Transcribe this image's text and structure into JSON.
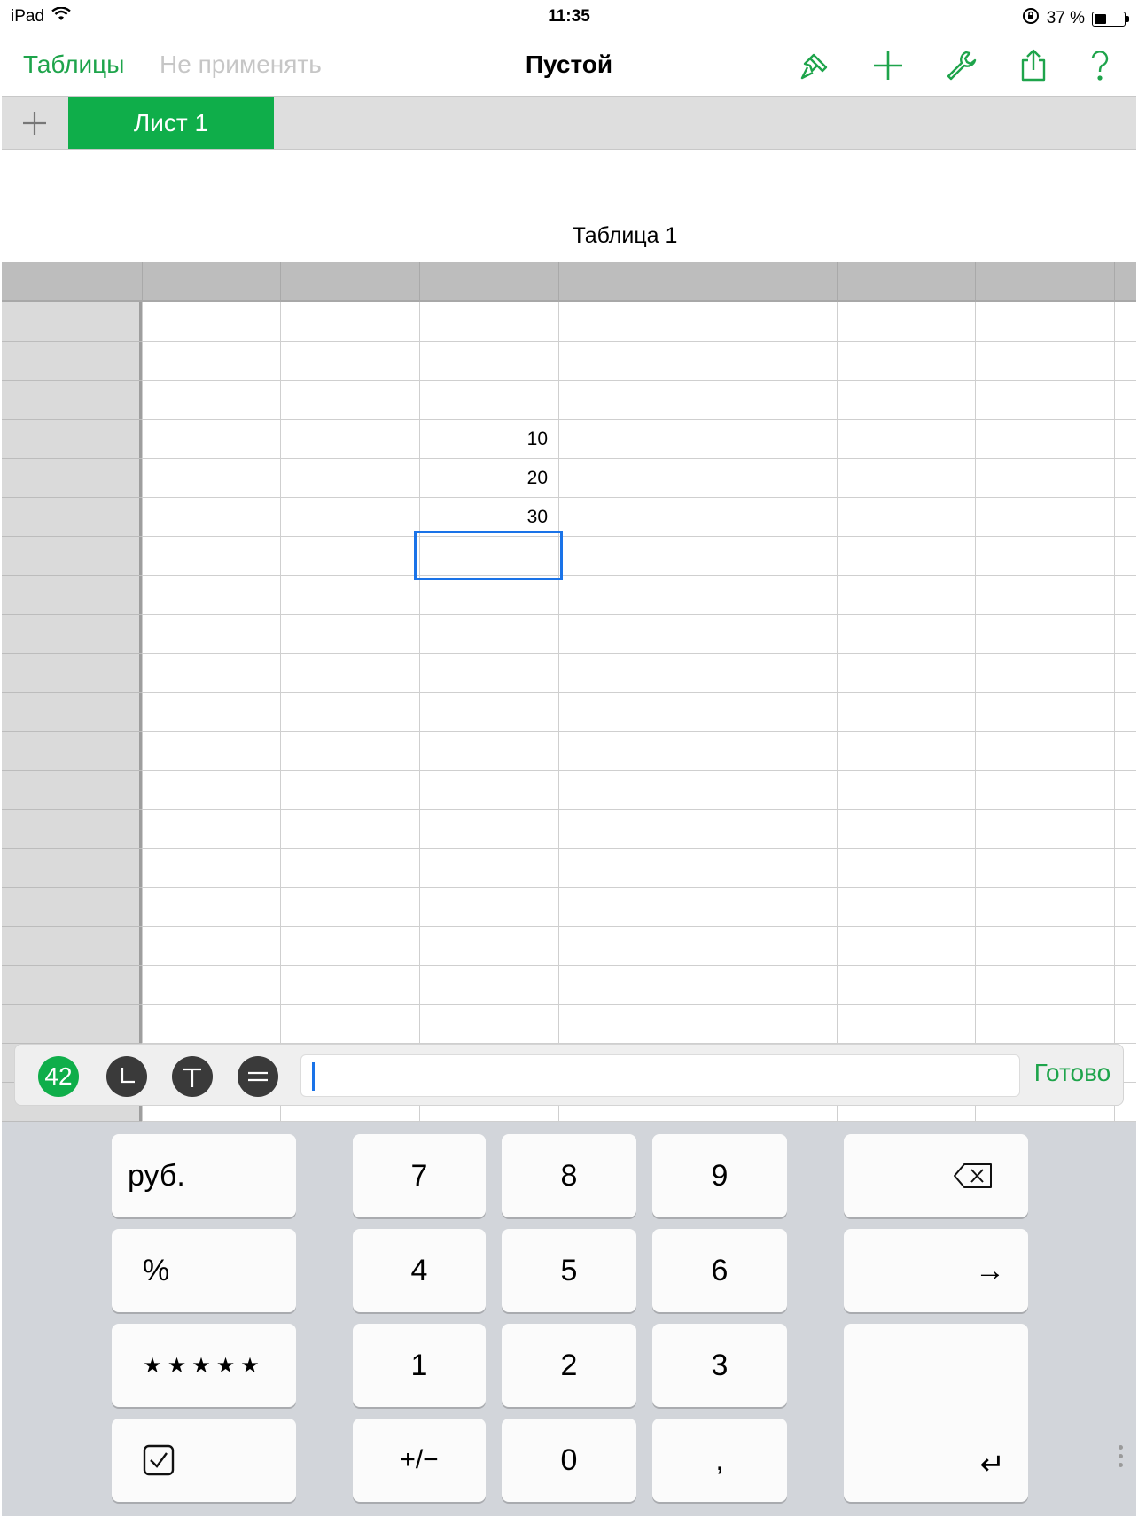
{
  "status_bar": {
    "device": "iPad",
    "time": "11:35",
    "battery_text": "37 %",
    "battery_level": 0.37
  },
  "nav": {
    "back_label": "Таблицы",
    "undo_label": "Не применять",
    "title": "Пустой",
    "icons": [
      "brush-icon",
      "plus-icon",
      "wrench-icon",
      "share-icon",
      "help-icon"
    ],
    "accent_color": "#1ea44b"
  },
  "sheets": {
    "add_icon": "plus-icon",
    "tabs": [
      {
        "label": "Лист 1",
        "active": true
      }
    ],
    "active_color": "#0fae4a"
  },
  "table": {
    "title": "Таблица 1",
    "cells": [
      {
        "row": 4,
        "col": 3,
        "value": "10"
      },
      {
        "row": 5,
        "col": 3,
        "value": "20"
      },
      {
        "row": 6,
        "col": 3,
        "value": "30"
      }
    ],
    "selected": {
      "row": 7,
      "col": 3
    }
  },
  "input_bar": {
    "formats": [
      {
        "name": "number-format",
        "label": "42"
      },
      {
        "name": "date-time-format",
        "icon": "clock-icon"
      },
      {
        "name": "text-format",
        "icon": "text-icon"
      },
      {
        "name": "formula-format",
        "icon": "equals-icon"
      }
    ],
    "value": "",
    "done_label": "Готово"
  },
  "keyboard": {
    "currency": "руб.",
    "percent": "%",
    "rating": "★★★★★",
    "checkbox_icon": "checkbox-icon",
    "digits": [
      "7",
      "8",
      "9",
      "4",
      "5",
      "6",
      "1",
      "2",
      "3"
    ],
    "sign": "+/−",
    "zero": "0",
    "decimal": ",",
    "delete_icon": "delete-icon",
    "next": "→",
    "return": "↵"
  }
}
